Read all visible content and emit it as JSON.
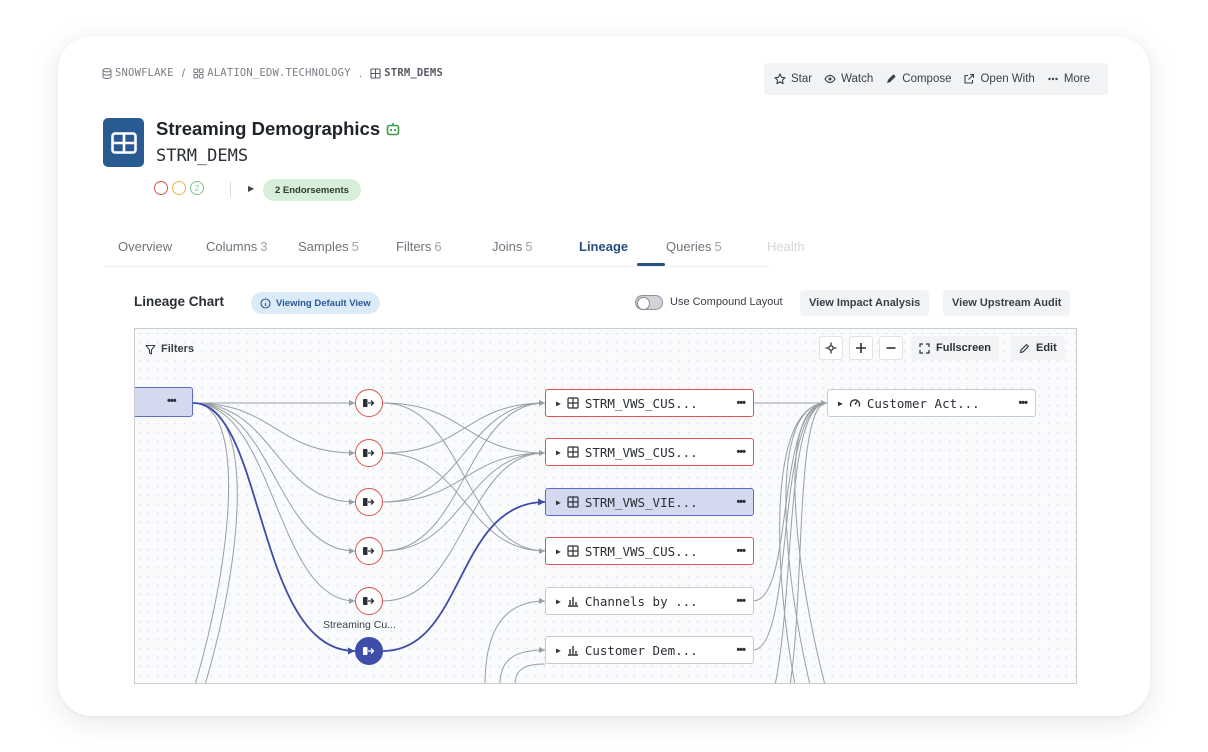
{
  "breadcrumb": {
    "source": "SNOWFLAKE",
    "schema": "ALATION_EDW.TECHNOLOGY",
    "dot": ".",
    "table": "STRM_DEMS",
    "separator": "/"
  },
  "actions": [
    {
      "label": "Star",
      "icon": "star-icon"
    },
    {
      "label": "Watch",
      "icon": "eye-icon"
    },
    {
      "label": "Compose",
      "icon": "pen-icon"
    },
    {
      "label": "Open With",
      "icon": "external-link-icon"
    },
    {
      "label": "More",
      "icon": "ellipsis-icon"
    }
  ],
  "header": {
    "title": "Streaming Demographics",
    "subtitle": "STRM_DEMS",
    "trust_count": "2",
    "endorsements": "2 Endorsements"
  },
  "tabs": [
    {
      "label": "Overview",
      "count": ""
    },
    {
      "label": "Columns",
      "count": "3"
    },
    {
      "label": "Samples",
      "count": "5"
    },
    {
      "label": "Filters",
      "count": "6"
    },
    {
      "label": "Joins",
      "count": "5"
    },
    {
      "label": "Lineage",
      "count": ""
    },
    {
      "label": "Queries",
      "count": "5"
    },
    {
      "label": "Health",
      "count": ""
    }
  ],
  "lineage": {
    "title": "Lineage Chart",
    "view_pill": "Viewing Default View",
    "compound_label": "Use Compound Layout",
    "impact_button": "View Impact Analysis",
    "audit_button": "View Upstream Audit"
  },
  "canvas": {
    "filters_label": "Filters",
    "fullscreen_label": "Fullscreen",
    "edit_label": "Edit",
    "process_label": "Streaming Cu...",
    "nodes": [
      {
        "label": "STRM_VWS_CUS...",
        "icon": "table-icon"
      },
      {
        "label": "STRM_VWS_CUS...",
        "icon": "table-icon"
      },
      {
        "label": "STRM_VWS_VIE...",
        "icon": "table-icon"
      },
      {
        "label": "STRM_VWS_CUS...",
        "icon": "table-icon"
      },
      {
        "label": "Channels by ...",
        "icon": "bar-chart-icon"
      },
      {
        "label": "Customer Dem...",
        "icon": "bar-chart-icon"
      },
      {
        "label": "Customer Act...",
        "icon": "gauge-icon"
      }
    ]
  },
  "colors": {
    "accent": "#274f82",
    "selected": "#3d4da8",
    "error": "#d9534f",
    "endorse": "#d7eed8"
  }
}
